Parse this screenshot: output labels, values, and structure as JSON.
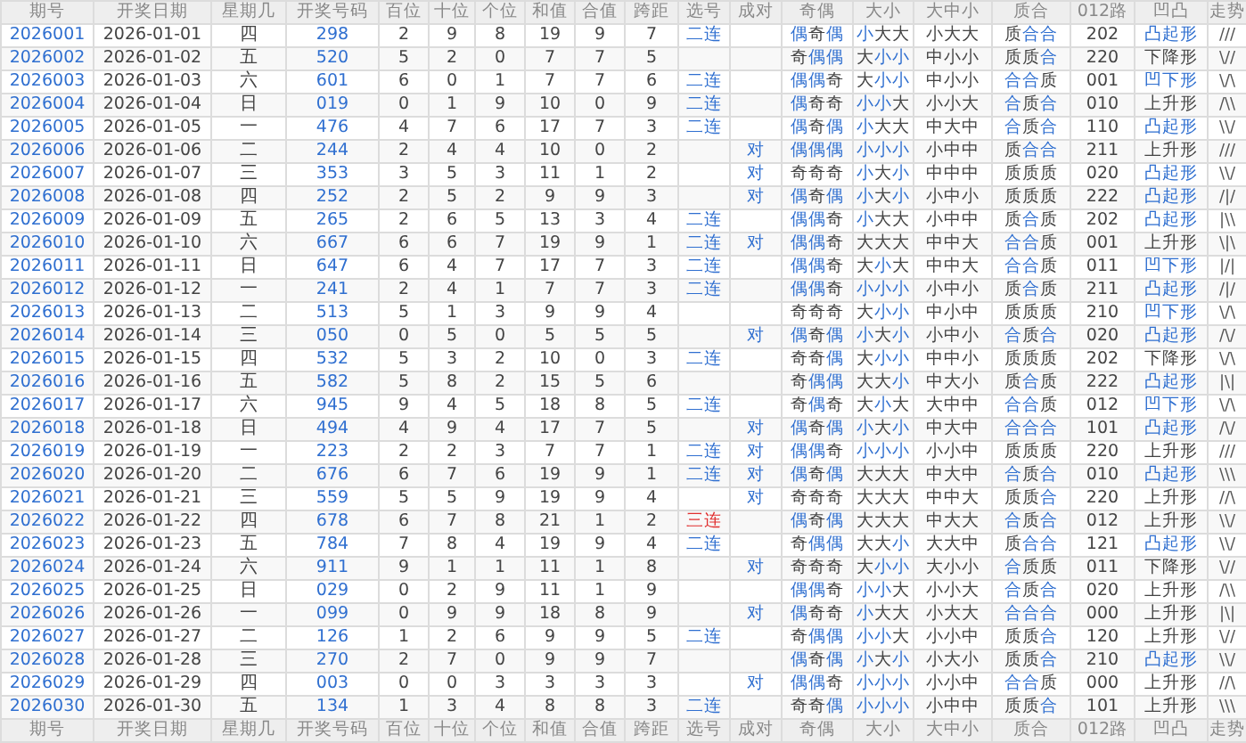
{
  "table": {
    "columns": [
      "期号",
      "开奖日期",
      "星期几",
      "开奖号码",
      "百位",
      "十位",
      "个位",
      "和值",
      "合值",
      "跨距",
      "选号",
      "成对",
      "奇偶",
      "大小",
      "大中小",
      "质合",
      "012路",
      "凹凸",
      "走势"
    ],
    "rows": [
      {
        "issue": "2026001",
        "date": "2026-01-01",
        "weekday": "四",
        "number": "298",
        "digits": [
          "2",
          "9",
          "8"
        ],
        "sum": "19",
        "sum_tail": "9",
        "span": "7",
        "pick": {
          "text": "二连",
          "color": "#2f6fd0"
        },
        "odd_even": {
          "text": "偶奇偶",
          "marked": [
            true,
            false,
            true
          ]
        },
        "big_small": {
          "text": "小大大",
          "marked": [
            true,
            false,
            false
          ]
        },
        "big_mid_small": "小大大",
        "prime_composite": {
          "text": "质合合",
          "marked": [
            false,
            true,
            true
          ]
        },
        "route_012": "202",
        "shape": {
          "text": "凸起形",
          "marked": true
        },
        "trend": "///"
      },
      {
        "issue": "2026002",
        "date": "2026-01-02",
        "weekday": "五",
        "number": "520",
        "digits": [
          "5",
          "2",
          "0"
        ],
        "sum": "7",
        "sum_tail": "7",
        "span": "5",
        "odd_even": {
          "text": "奇偶偶",
          "marked": [
            false,
            true,
            true
          ]
        },
        "big_small": {
          "text": "大小小",
          "marked": [
            false,
            true,
            true
          ]
        },
        "big_mid_small": "中小小",
        "prime_composite": {
          "text": "质质合",
          "marked": [
            false,
            false,
            true
          ]
        },
        "route_012": "220",
        "shape": {
          "text": "下降形",
          "marked": false
        },
        "trend": "\\//"
      },
      {
        "issue": "2026003",
        "date": "2026-01-03",
        "weekday": "六",
        "number": "601",
        "digits": [
          "6",
          "0",
          "1"
        ],
        "sum": "7",
        "sum_tail": "7",
        "span": "6",
        "pick": {
          "text": "二连",
          "color": "#2f6fd0"
        },
        "odd_even": {
          "text": "偶偶奇",
          "marked": [
            true,
            true,
            false
          ]
        },
        "big_small": {
          "text": "大小小",
          "marked": [
            false,
            true,
            true
          ]
        },
        "big_mid_small": "中小小",
        "prime_composite": {
          "text": "合合质",
          "marked": [
            true,
            true,
            false
          ]
        },
        "route_012": "001",
        "shape": {
          "text": "凹下形",
          "marked": true
        },
        "trend": "\\/\\"
      },
      {
        "issue": "2026004",
        "date": "2026-01-04",
        "weekday": "日",
        "number": "019",
        "digits": [
          "0",
          "1",
          "9"
        ],
        "sum": "10",
        "sum_tail": "0",
        "span": "9",
        "pick": {
          "text": "二连",
          "color": "#2f6fd0"
        },
        "odd_even": {
          "text": "偶奇奇",
          "marked": [
            true,
            false,
            false
          ]
        },
        "big_small": {
          "text": "小小大",
          "marked": [
            true,
            true,
            false
          ]
        },
        "big_mid_small": "小小大",
        "prime_composite": {
          "text": "合质合",
          "marked": [
            true,
            false,
            true
          ]
        },
        "route_012": "010",
        "shape": {
          "text": "上升形",
          "marked": false
        },
        "trend": "/\\\\"
      },
      {
        "issue": "2026005",
        "date": "2026-01-05",
        "weekday": "一",
        "number": "476",
        "digits": [
          "4",
          "7",
          "6"
        ],
        "sum": "17",
        "sum_tail": "7",
        "span": "3",
        "pick": {
          "text": "二连",
          "color": "#2f6fd0"
        },
        "odd_even": {
          "text": "偶奇偶",
          "marked": [
            true,
            false,
            true
          ]
        },
        "big_small": {
          "text": "小大大",
          "marked": [
            true,
            false,
            false
          ]
        },
        "big_mid_small": "中大中",
        "prime_composite": {
          "text": "合质合",
          "marked": [
            true,
            false,
            true
          ]
        },
        "route_012": "110",
        "shape": {
          "text": "凸起形",
          "marked": true
        },
        "trend": "\\\\/"
      },
      {
        "issue": "2026006",
        "date": "2026-01-06",
        "weekday": "二",
        "number": "244",
        "digits": [
          "2",
          "4",
          "4"
        ],
        "sum": "10",
        "sum_tail": "0",
        "span": "2",
        "pair": "对",
        "odd_even": {
          "text": "偶偶偶",
          "marked": [
            true,
            true,
            true
          ]
        },
        "big_small": {
          "text": "小小小",
          "marked": [
            true,
            true,
            true
          ]
        },
        "big_mid_small": "小中中",
        "prime_composite": {
          "text": "质合合",
          "marked": [
            false,
            true,
            true
          ]
        },
        "route_012": "211",
        "shape": {
          "text": "上升形",
          "marked": false
        },
        "trend": "///"
      },
      {
        "issue": "2026007",
        "date": "2026-01-07",
        "weekday": "三",
        "number": "353",
        "digits": [
          "3",
          "5",
          "3"
        ],
        "sum": "11",
        "sum_tail": "1",
        "span": "2",
        "pair": "对",
        "odd_even": {
          "text": "奇奇奇",
          "marked": [
            false,
            false,
            false
          ]
        },
        "big_small": {
          "text": "小大小",
          "marked": [
            true,
            false,
            true
          ]
        },
        "big_mid_small": "中中中",
        "prime_composite": {
          "text": "质质质",
          "marked": [
            false,
            false,
            false
          ]
        },
        "route_012": "020",
        "shape": {
          "text": "凸起形",
          "marked": true
        },
        "trend": "\\\\/"
      },
      {
        "issue": "2026008",
        "date": "2026-01-08",
        "weekday": "四",
        "number": "252",
        "digits": [
          "2",
          "5",
          "2"
        ],
        "sum": "9",
        "sum_tail": "9",
        "span": "3",
        "pair": "对",
        "odd_even": {
          "text": "偶奇偶",
          "marked": [
            true,
            false,
            true
          ]
        },
        "big_small": {
          "text": "小大小",
          "marked": [
            true,
            false,
            true
          ]
        },
        "big_mid_small": "小中小",
        "prime_composite": {
          "text": "质质质",
          "marked": [
            false,
            false,
            false
          ]
        },
        "route_012": "222",
        "shape": {
          "text": "凸起形",
          "marked": true
        },
        "trend": "/|/"
      },
      {
        "issue": "2026009",
        "date": "2026-01-09",
        "weekday": "五",
        "number": "265",
        "digits": [
          "2",
          "6",
          "5"
        ],
        "sum": "13",
        "sum_tail": "3",
        "span": "4",
        "pick": {
          "text": "二连",
          "color": "#2f6fd0"
        },
        "odd_even": {
          "text": "偶偶奇",
          "marked": [
            true,
            true,
            false
          ]
        },
        "big_small": {
          "text": "小大大",
          "marked": [
            true,
            false,
            false
          ]
        },
        "big_mid_small": "小中中",
        "prime_composite": {
          "text": "质合质",
          "marked": [
            false,
            true,
            false
          ]
        },
        "route_012": "202",
        "shape": {
          "text": "凸起形",
          "marked": true
        },
        "trend": "|\\\\"
      },
      {
        "issue": "2026010",
        "date": "2026-01-10",
        "weekday": "六",
        "number": "667",
        "digits": [
          "6",
          "6",
          "7"
        ],
        "sum": "19",
        "sum_tail": "9",
        "span": "1",
        "pick": {
          "text": "二连",
          "color": "#2f6fd0"
        },
        "pair": "对",
        "odd_even": {
          "text": "偶偶奇",
          "marked": [
            true,
            true,
            false
          ]
        },
        "big_small": {
          "text": "大大大",
          "marked": [
            false,
            false,
            false
          ]
        },
        "big_mid_small": "中中大",
        "prime_composite": {
          "text": "合合质",
          "marked": [
            true,
            true,
            false
          ]
        },
        "route_012": "001",
        "shape": {
          "text": "上升形",
          "marked": false
        },
        "trend": "\\|\\"
      },
      {
        "issue": "2026011",
        "date": "2026-01-11",
        "weekday": "日",
        "number": "647",
        "digits": [
          "6",
          "4",
          "7"
        ],
        "sum": "17",
        "sum_tail": "7",
        "span": "3",
        "pick": {
          "text": "二连",
          "color": "#2f6fd0"
        },
        "odd_even": {
          "text": "偶偶奇",
          "marked": [
            true,
            true,
            false
          ]
        },
        "big_small": {
          "text": "大小大",
          "marked": [
            false,
            true,
            false
          ]
        },
        "big_mid_small": "中中大",
        "prime_composite": {
          "text": "合合质",
          "marked": [
            true,
            true,
            false
          ]
        },
        "route_012": "011",
        "shape": {
          "text": "凹下形",
          "marked": true
        },
        "trend": "|/|"
      },
      {
        "issue": "2026012",
        "date": "2026-01-12",
        "weekday": "一",
        "number": "241",
        "digits": [
          "2",
          "4",
          "1"
        ],
        "sum": "7",
        "sum_tail": "7",
        "span": "3",
        "pick": {
          "text": "二连",
          "color": "#2f6fd0"
        },
        "odd_even": {
          "text": "偶偶奇",
          "marked": [
            true,
            true,
            false
          ]
        },
        "big_small": {
          "text": "小小小",
          "marked": [
            true,
            true,
            true
          ]
        },
        "big_mid_small": "小中小",
        "prime_composite": {
          "text": "质合质",
          "marked": [
            false,
            true,
            false
          ]
        },
        "route_012": "211",
        "shape": {
          "text": "凸起形",
          "marked": true
        },
        "trend": "/|/"
      },
      {
        "issue": "2026013",
        "date": "2026-01-13",
        "weekday": "二",
        "number": "513",
        "digits": [
          "5",
          "1",
          "3"
        ],
        "sum": "9",
        "sum_tail": "9",
        "span": "4",
        "odd_even": {
          "text": "奇奇奇",
          "marked": [
            false,
            false,
            false
          ]
        },
        "big_small": {
          "text": "大小小",
          "marked": [
            false,
            true,
            true
          ]
        },
        "big_mid_small": "中小中",
        "prime_composite": {
          "text": "质质质",
          "marked": [
            false,
            false,
            false
          ]
        },
        "route_012": "210",
        "shape": {
          "text": "凹下形",
          "marked": true
        },
        "trend": "\\/\\"
      },
      {
        "issue": "2026014",
        "date": "2026-01-14",
        "weekday": "三",
        "number": "050",
        "digits": [
          "0",
          "5",
          "0"
        ],
        "sum": "5",
        "sum_tail": "5",
        "span": "5",
        "pair": "对",
        "odd_even": {
          "text": "偶奇偶",
          "marked": [
            true,
            false,
            true
          ]
        },
        "big_small": {
          "text": "小大小",
          "marked": [
            true,
            false,
            true
          ]
        },
        "big_mid_small": "小中小",
        "prime_composite": {
          "text": "合质合",
          "marked": [
            true,
            false,
            true
          ]
        },
        "route_012": "020",
        "shape": {
          "text": "凸起形",
          "marked": true
        },
        "trend": "/\\/"
      },
      {
        "issue": "2026015",
        "date": "2026-01-15",
        "weekday": "四",
        "number": "532",
        "digits": [
          "5",
          "3",
          "2"
        ],
        "sum": "10",
        "sum_tail": "0",
        "span": "3",
        "pick": {
          "text": "二连",
          "color": "#2f6fd0"
        },
        "odd_even": {
          "text": "奇奇偶",
          "marked": [
            false,
            false,
            true
          ]
        },
        "big_small": {
          "text": "大小小",
          "marked": [
            false,
            true,
            true
          ]
        },
        "big_mid_small": "中中小",
        "prime_composite": {
          "text": "质质质",
          "marked": [
            false,
            false,
            false
          ]
        },
        "route_012": "202",
        "shape": {
          "text": "下降形",
          "marked": false
        },
        "trend": "\\/\\"
      },
      {
        "issue": "2026016",
        "date": "2026-01-16",
        "weekday": "五",
        "number": "582",
        "digits": [
          "5",
          "8",
          "2"
        ],
        "sum": "15",
        "sum_tail": "5",
        "span": "6",
        "odd_even": {
          "text": "奇偶偶",
          "marked": [
            false,
            true,
            true
          ]
        },
        "big_small": {
          "text": "大大小",
          "marked": [
            false,
            false,
            true
          ]
        },
        "big_mid_small": "中大小",
        "prime_composite": {
          "text": "质合质",
          "marked": [
            false,
            true,
            false
          ]
        },
        "route_012": "222",
        "shape": {
          "text": "凸起形",
          "marked": true
        },
        "trend": "|\\|"
      },
      {
        "issue": "2026017",
        "date": "2026-01-17",
        "weekday": "六",
        "number": "945",
        "digits": [
          "9",
          "4",
          "5"
        ],
        "sum": "18",
        "sum_tail": "8",
        "span": "5",
        "pick": {
          "text": "二连",
          "color": "#2f6fd0"
        },
        "odd_even": {
          "text": "奇偶奇",
          "marked": [
            false,
            true,
            false
          ]
        },
        "big_small": {
          "text": "大小大",
          "marked": [
            false,
            true,
            false
          ]
        },
        "big_mid_small": "大中中",
        "prime_composite": {
          "text": "合合质",
          "marked": [
            true,
            true,
            false
          ]
        },
        "route_012": "012",
        "shape": {
          "text": "凹下形",
          "marked": true
        },
        "trend": "\\/\\"
      },
      {
        "issue": "2026018",
        "date": "2026-01-18",
        "weekday": "日",
        "number": "494",
        "digits": [
          "4",
          "9",
          "4"
        ],
        "sum": "17",
        "sum_tail": "7",
        "span": "5",
        "pair": "对",
        "odd_even": {
          "text": "偶奇偶",
          "marked": [
            true,
            false,
            true
          ]
        },
        "big_small": {
          "text": "小大小",
          "marked": [
            true,
            false,
            true
          ]
        },
        "big_mid_small": "中大中",
        "prime_composite": {
          "text": "合合合",
          "marked": [
            true,
            true,
            true
          ]
        },
        "route_012": "101",
        "shape": {
          "text": "凸起形",
          "marked": true
        },
        "trend": "/\\/"
      },
      {
        "issue": "2026019",
        "date": "2026-01-19",
        "weekday": "一",
        "number": "223",
        "digits": [
          "2",
          "2",
          "3"
        ],
        "sum": "7",
        "sum_tail": "7",
        "span": "1",
        "pick": {
          "text": "二连",
          "color": "#2f6fd0"
        },
        "pair": "对",
        "odd_even": {
          "text": "偶偶奇",
          "marked": [
            true,
            true,
            false
          ]
        },
        "big_small": {
          "text": "小小小",
          "marked": [
            true,
            true,
            true
          ]
        },
        "big_mid_small": "小小中",
        "prime_composite": {
          "text": "质质质",
          "marked": [
            false,
            false,
            false
          ]
        },
        "route_012": "220",
        "shape": {
          "text": "上升形",
          "marked": false
        },
        "trend": "///"
      },
      {
        "issue": "2026020",
        "date": "2026-01-20",
        "weekday": "二",
        "number": "676",
        "digits": [
          "6",
          "7",
          "6"
        ],
        "sum": "19",
        "sum_tail": "9",
        "span": "1",
        "pick": {
          "text": "二连",
          "color": "#2f6fd0"
        },
        "pair": "对",
        "odd_even": {
          "text": "偶奇偶",
          "marked": [
            true,
            false,
            true
          ]
        },
        "big_small": {
          "text": "大大大",
          "marked": [
            false,
            false,
            false
          ]
        },
        "big_mid_small": "中大中",
        "prime_composite": {
          "text": "合质合",
          "marked": [
            true,
            false,
            true
          ]
        },
        "route_012": "010",
        "shape": {
          "text": "凸起形",
          "marked": true
        },
        "trend": "\\\\\\"
      },
      {
        "issue": "2026021",
        "date": "2026-01-21",
        "weekday": "三",
        "number": "559",
        "digits": [
          "5",
          "5",
          "9"
        ],
        "sum": "19",
        "sum_tail": "9",
        "span": "4",
        "pair": "对",
        "odd_even": {
          "text": "奇奇奇",
          "marked": [
            false,
            false,
            false
          ]
        },
        "big_small": {
          "text": "大大大",
          "marked": [
            false,
            false,
            false
          ]
        },
        "big_mid_small": "中中大",
        "prime_composite": {
          "text": "质质合",
          "marked": [
            false,
            false,
            true
          ]
        },
        "route_012": "220",
        "shape": {
          "text": "上升形",
          "marked": false
        },
        "trend": "//\\"
      },
      {
        "issue": "2026022",
        "date": "2026-01-22",
        "weekday": "四",
        "number": "678",
        "digits": [
          "6",
          "7",
          "8"
        ],
        "sum": "21",
        "sum_tail": "1",
        "span": "2",
        "pick": {
          "text": "三连",
          "color": "#e03030"
        },
        "odd_even": {
          "text": "偶奇偶",
          "marked": [
            true,
            false,
            true
          ]
        },
        "big_small": {
          "text": "大大大",
          "marked": [
            false,
            false,
            false
          ]
        },
        "big_mid_small": "中大大",
        "prime_composite": {
          "text": "合质合",
          "marked": [
            true,
            false,
            true
          ]
        },
        "route_012": "012",
        "shape": {
          "text": "上升形",
          "marked": false
        },
        "trend": "\\\\/"
      },
      {
        "issue": "2026023",
        "date": "2026-01-23",
        "weekday": "五",
        "number": "784",
        "digits": [
          "7",
          "8",
          "4"
        ],
        "sum": "19",
        "sum_tail": "9",
        "span": "4",
        "pick": {
          "text": "二连",
          "color": "#2f6fd0"
        },
        "odd_even": {
          "text": "奇偶偶",
          "marked": [
            false,
            true,
            true
          ]
        },
        "big_small": {
          "text": "大大小",
          "marked": [
            false,
            false,
            true
          ]
        },
        "big_mid_small": "大大中",
        "prime_composite": {
          "text": "质合合",
          "marked": [
            false,
            true,
            true
          ]
        },
        "route_012": "121",
        "shape": {
          "text": "凸起形",
          "marked": true
        },
        "trend": "\\\\/"
      },
      {
        "issue": "2026024",
        "date": "2026-01-24",
        "weekday": "六",
        "number": "911",
        "digits": [
          "9",
          "1",
          "1"
        ],
        "sum": "11",
        "sum_tail": "1",
        "span": "8",
        "pair": "对",
        "odd_even": {
          "text": "奇奇奇",
          "marked": [
            false,
            false,
            false
          ]
        },
        "big_small": {
          "text": "大小小",
          "marked": [
            false,
            true,
            true
          ]
        },
        "big_mid_small": "大小小",
        "prime_composite": {
          "text": "合质质",
          "marked": [
            true,
            false,
            false
          ]
        },
        "route_012": "011",
        "shape": {
          "text": "下降形",
          "marked": false
        },
        "trend": "\\//"
      },
      {
        "issue": "2026025",
        "date": "2026-01-25",
        "weekday": "日",
        "number": "029",
        "digits": [
          "0",
          "2",
          "9"
        ],
        "sum": "11",
        "sum_tail": "1",
        "span": "9",
        "odd_even": {
          "text": "偶偶奇",
          "marked": [
            true,
            true,
            false
          ]
        },
        "big_small": {
          "text": "小小大",
          "marked": [
            true,
            true,
            false
          ]
        },
        "big_mid_small": "小小大",
        "prime_composite": {
          "text": "合质合",
          "marked": [
            true,
            false,
            true
          ]
        },
        "route_012": "020",
        "shape": {
          "text": "上升形",
          "marked": false
        },
        "trend": "/\\\\"
      },
      {
        "issue": "2026026",
        "date": "2026-01-26",
        "weekday": "一",
        "number": "099",
        "digits": [
          "0",
          "9",
          "9"
        ],
        "sum": "18",
        "sum_tail": "8",
        "span": "9",
        "pair": "对",
        "odd_even": {
          "text": "偶奇奇",
          "marked": [
            true,
            false,
            false
          ]
        },
        "big_small": {
          "text": "小大大",
          "marked": [
            true,
            false,
            false
          ]
        },
        "big_mid_small": "小大大",
        "prime_composite": {
          "text": "合合合",
          "marked": [
            true,
            true,
            true
          ]
        },
        "route_012": "000",
        "shape": {
          "text": "上升形",
          "marked": false
        },
        "trend": "|\\|"
      },
      {
        "issue": "2026027",
        "date": "2026-01-27",
        "weekday": "二",
        "number": "126",
        "digits": [
          "1",
          "2",
          "6"
        ],
        "sum": "9",
        "sum_tail": "9",
        "span": "5",
        "pick": {
          "text": "二连",
          "color": "#2f6fd0"
        },
        "odd_even": {
          "text": "奇偶偶",
          "marked": [
            false,
            true,
            true
          ]
        },
        "big_small": {
          "text": "小小大",
          "marked": [
            true,
            true,
            false
          ]
        },
        "big_mid_small": "小小中",
        "prime_composite": {
          "text": "质质合",
          "marked": [
            false,
            false,
            true
          ]
        },
        "route_012": "120",
        "shape": {
          "text": "上升形",
          "marked": false
        },
        "trend": "\\//"
      },
      {
        "issue": "2026028",
        "date": "2026-01-28",
        "weekday": "三",
        "number": "270",
        "digits": [
          "2",
          "7",
          "0"
        ],
        "sum": "9",
        "sum_tail": "9",
        "span": "7",
        "odd_even": {
          "text": "偶奇偶",
          "marked": [
            true,
            false,
            true
          ]
        },
        "big_small": {
          "text": "小大小",
          "marked": [
            true,
            false,
            true
          ]
        },
        "big_mid_small": "小大小",
        "prime_composite": {
          "text": "质质合",
          "marked": [
            false,
            false,
            true
          ]
        },
        "route_012": "210",
        "shape": {
          "text": "凸起形",
          "marked": true
        },
        "trend": "\\\\/"
      },
      {
        "issue": "2026029",
        "date": "2026-01-29",
        "weekday": "四",
        "number": "003",
        "digits": [
          "0",
          "0",
          "3"
        ],
        "sum": "3",
        "sum_tail": "3",
        "span": "3",
        "pair": "对",
        "odd_even": {
          "text": "偶偶奇",
          "marked": [
            true,
            true,
            false
          ]
        },
        "big_small": {
          "text": "小小小",
          "marked": [
            true,
            true,
            true
          ]
        },
        "big_mid_small": "小小中",
        "prime_composite": {
          "text": "合合质",
          "marked": [
            true,
            true,
            false
          ]
        },
        "route_012": "000",
        "shape": {
          "text": "上升形",
          "marked": false
        },
        "trend": "//\\"
      },
      {
        "issue": "2026030",
        "date": "2026-01-30",
        "weekday": "五",
        "number": "134",
        "digits": [
          "1",
          "3",
          "4"
        ],
        "sum": "8",
        "sum_tail": "8",
        "span": "3",
        "pick": {
          "text": "二连",
          "color": "#2f6fd0"
        },
        "odd_even": {
          "text": "奇奇偶",
          "marked": [
            false,
            false,
            true
          ]
        },
        "big_small": {
          "text": "小小小",
          "marked": [
            true,
            true,
            true
          ]
        },
        "big_mid_small": "小中中",
        "prime_composite": {
          "text": "质质合",
          "marked": [
            false,
            false,
            true
          ]
        },
        "route_012": "101",
        "shape": {
          "text": "上升形",
          "marked": false
        },
        "trend": "\\\\\\"
      }
    ],
    "footer_columns": [
      "期号",
      "开奖日期",
      "星期几",
      "开奖号码",
      "百位",
      "十位",
      "个位",
      "和值",
      "合值",
      "跨距",
      "选号",
      "成对",
      "奇偶",
      "大小",
      "大中小",
      "质合",
      "012路",
      "凹凸",
      "走势"
    ]
  }
}
